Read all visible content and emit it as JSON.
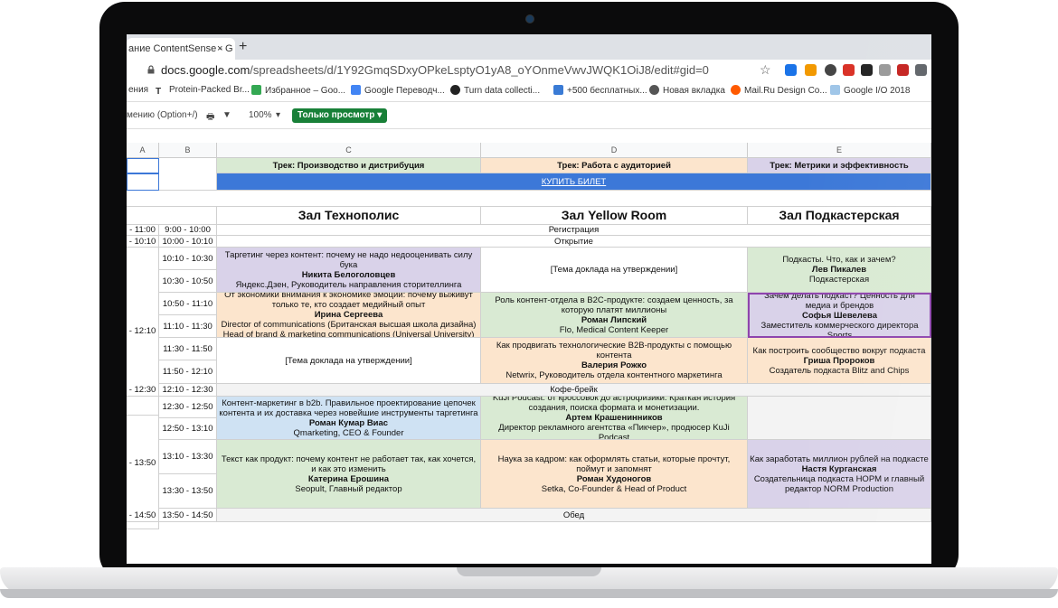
{
  "browser": {
    "tab_title": "ание ContentSense - G",
    "tab_close": "×",
    "new_tab": "+",
    "url_host": "docs.google.com",
    "url_path": "/spreadsheets/d/1Y92GmqSDxyOPkeLsptyO1yA8_oYOnmeVwvJWQK1OiJ8/edit#gid=0",
    "star": "☆",
    "bookmarks": [
      "ения",
      "Protein-Packed Br...",
      "Избранное – Goo...",
      "Google Переводч...",
      "Turn data collecti...",
      "+500 бесплатных...",
      "Новая вкладка",
      "Mail.Ru Design Co...",
      "Google I/O 2018"
    ]
  },
  "toolbar": {
    "font_hint": "мению (Option+/)",
    "zoom": "100%",
    "view_only": "Только просмотр ▾"
  },
  "columns": [
    "A",
    "B",
    "C",
    "D",
    "E"
  ],
  "tracks": {
    "c": "Трек: Производство и дистрибуция",
    "d": "Трек: Работа с аудиторией",
    "e": "Трек: Метрики и эффективность"
  },
  "buy_ticket": "КУПИТЬ БИЛЕТ",
  "halls": {
    "c": "Зал Технополис",
    "d": "Зал Yellow Room",
    "e": "Зал Подкастерская"
  },
  "a_times": [
    "- 11:00",
    "- 10:10",
    "- 12:10",
    "- 12:30",
    "- 13:50",
    "- 14:50"
  ],
  "b_times": [
    "9:00 - 10:00",
    "10:00 - 10:10",
    "10:10 - 10:30",
    "10:30 - 10:50",
    "10:50 - 11:10",
    "11:10 - 11:30",
    "11:30 - 11:50",
    "11:50 - 12:10",
    "12:10 - 12:30",
    "12:30 - 12:50",
    "12:50 - 13:10",
    "13:10 - 13:30",
    "13:30 - 13:50",
    "13:50 - 14:50"
  ],
  "merged": {
    "registration": "Регистрация",
    "opening": "Открытие",
    "coffee": "Кофе-брейк",
    "lunch": "Обед"
  },
  "talks": {
    "c1": {
      "t": "Таргетинг через контент: почему не надо недооценивать силу бука",
      "n": "Никита Белоголовцев",
      "r": "Яндекс.Дзен, Руководитель направления сторителлинга"
    },
    "c2": {
      "t": "От экономики внимания к экономике эмоций: почему выживут только те, кто создает медийный опыт",
      "n": "Ирина Сергеева",
      "r": "Director of communications (Британская высшая школа дизайна) Head of brand & marketing communications (Universal University)"
    },
    "c3": {
      "t": "[Тема доклада на утверждении]",
      "n": "",
      "r": ""
    },
    "c4": {
      "t": "Контент-маркетинг в b2b. Правильное проектирование цепочек контента и их доставка через новейшие инструменты таргетинга",
      "n": "Роман Кумар Виас",
      "r": "Qmarketing, CEO & Founder"
    },
    "c5": {
      "t": "Текст как продукт: почему контент не работает так, как хочется, и как это изменить",
      "n": "Катерина Ерошина",
      "r": "Seopult, Главный редактор"
    },
    "d1": {
      "t": "[Тема доклада на утверждении]",
      "n": "",
      "r": ""
    },
    "d2": {
      "t": "Роль контент-отдела в B2C-продукте: создаем ценность, за которую платят миллионы",
      "n": "Роман Липский",
      "r": "Flo, Medical Content Keeper"
    },
    "d3": {
      "t": "Как продвигать технологические B2B-продукты с помощью контента",
      "n": "Валерия Рожко",
      "r": "Netwrix, Руководитель отдела контентного маркетинга"
    },
    "d4": {
      "t": "KuJi Podcast: от кроссовок до астрофизики. Краткая история создания, поиска формата и монетизации.",
      "n": "Артем Крашенинников",
      "r": "Директор рекламного агентства «Пикчер», продюсер KuJi Podcast"
    },
    "d5": {
      "t": "Наука за кадром: как оформлять статьи, которые прочтут, поймут и запомнят",
      "n": "Роман Худоногов",
      "r": "Setka, Co-Founder & Head of Product"
    },
    "e1": {
      "t": "Подкасты. Что, как и зачем?",
      "n": "Лев Пикалев",
      "r": "Подкастерская"
    },
    "e2": {
      "t": "Зачем делать подкаст? Ценность для медиа и брендов",
      "n": "Софья Шевелева",
      "r": "Заместитель коммерческого директора Sports"
    },
    "e3": {
      "t": "Как построить сообщество вокруг подкаста",
      "n": "Гриша Пророков",
      "r": "Создатель подкаста Blitz and Chips"
    },
    "e5": {
      "t": "Как заработать миллион рублей на подкасте",
      "n": "Настя Курганская",
      "r": "Создательница подкаста HOPM и главный редактор NORM Production"
    }
  }
}
